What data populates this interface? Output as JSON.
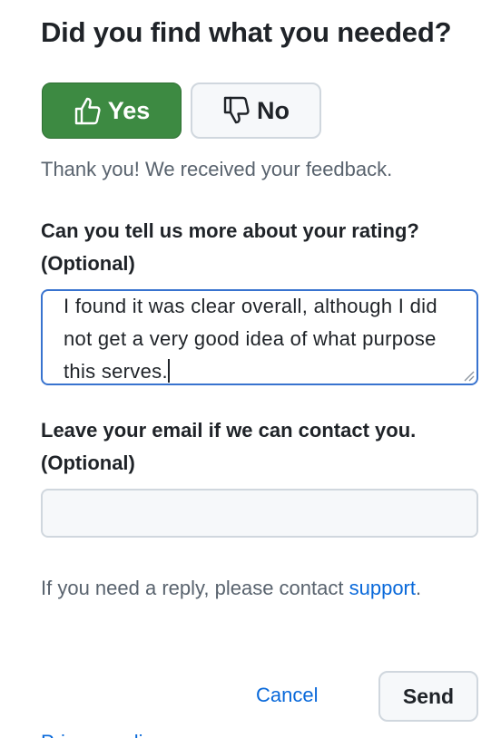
{
  "feedback": {
    "title": "Did you find what you needed?",
    "yes_label": "Yes",
    "no_label": "No",
    "selected": "yes",
    "thanks_message": "Thank you! We received your feedback.",
    "rating_label": "Can you tell us more about your rating? (Optional)",
    "rating_text": "I found it was clear overall, although I did not get a very good idea of what purpose this serves.",
    "email_label": "Leave your email if we can contact you. (Optional)",
    "email_value": "",
    "reply_note": "If you need a reply, please contact",
    "support_link": "support",
    "reply_period": ".",
    "cancel_label": "Cancel",
    "send_label": "Send",
    "clipped_link_label": "Privacy policy"
  },
  "colors": {
    "yes_bg": "#3d8a42",
    "focus_border": "#3873cf",
    "link": "#0969da",
    "muted_text": "#59636e"
  },
  "icons": {
    "yes": "thumbs-up-icon",
    "no": "thumbs-down-icon"
  }
}
